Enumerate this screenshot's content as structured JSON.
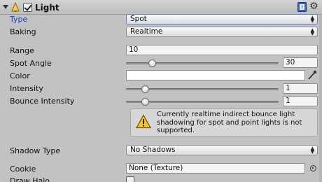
{
  "component": {
    "title": "Light",
    "enabled": true
  },
  "fields": {
    "type": {
      "label": "Type",
      "value": "Spot"
    },
    "baking": {
      "label": "Baking",
      "value": "Realtime"
    },
    "range": {
      "label": "Range",
      "value": "10"
    },
    "spot_angle": {
      "label": "Spot Angle",
      "value": "30",
      "slider_fraction": 0.17
    },
    "color": {
      "label": "Color",
      "value_hex": "#ffffff"
    },
    "intensity": {
      "label": "Intensity",
      "value": "1",
      "slider_fraction": 0.125
    },
    "bounce_intensity": {
      "label": "Bounce Intensity",
      "value": "1",
      "slider_fraction": 0.125
    },
    "help": {
      "text": "Currently realtime indirect bounce light shadowing for spot and point lights is not supported."
    },
    "shadow_type": {
      "label": "Shadow Type",
      "value": "No Shadows"
    },
    "cookie": {
      "label": "Cookie",
      "value": "None (Texture)"
    },
    "draw_halo": {
      "label": "Draw Halo",
      "checked": false
    }
  },
  "colors": {
    "active_label": "#1a3fd0",
    "panel_bg": "#c2c2c2",
    "warning": "#f2c230"
  }
}
